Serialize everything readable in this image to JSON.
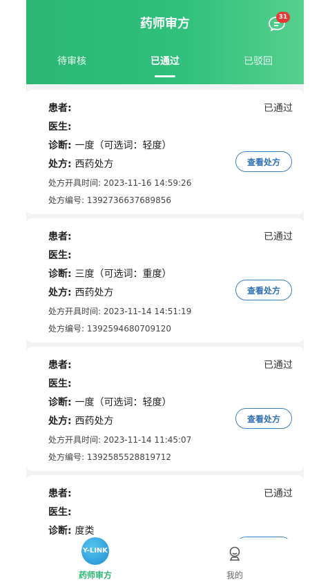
{
  "header": {
    "title": "药师审方",
    "message_count": "31"
  },
  "tabs": [
    {
      "label": "待审核",
      "active": false
    },
    {
      "label": "已通过",
      "active": true
    },
    {
      "label": "已驳回",
      "active": false
    }
  ],
  "labels": {
    "patient": "患者:",
    "doctor": "医生:",
    "diagnosis": "诊断:",
    "rx_type": "处方:",
    "rx_time": "处方开具时间:",
    "rx_no": "处方编号:",
    "view_button": "查看处方"
  },
  "cards": [
    {
      "status": "已通过",
      "diagnosis": "一度（可选词：轻度）",
      "rx_type": "西药处方",
      "rx_time": "2023-11-16 14:59:26",
      "rx_no": "1392736637689856"
    },
    {
      "status": "已通过",
      "diagnosis": "三度（可选词：重度）",
      "rx_type": "西药处方",
      "rx_time": "2023-11-14 14:51:19",
      "rx_no": "1392594680709120"
    },
    {
      "status": "已通过",
      "diagnosis": "一度（可选词：轻度）",
      "rx_type": "西药处方",
      "rx_time": "2023-11-14 11:45:07",
      "rx_no": "1392585528819712"
    },
    {
      "status": "已通过",
      "diagnosis": "度类"
    }
  ],
  "bottom_nav": {
    "home_icon_text": "Y-LINK",
    "home_label": "药师审方",
    "mine_label": "我的"
  },
  "colors": {
    "header_green": "#2fc07b",
    "button_blue": "#3b82c4",
    "badge_red": "#e53935"
  }
}
